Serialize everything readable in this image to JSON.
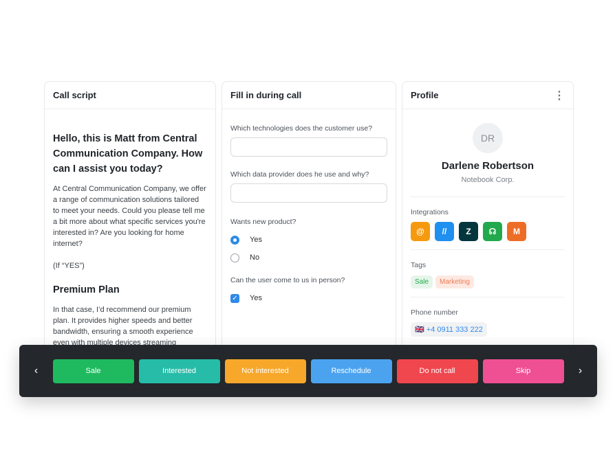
{
  "call_script": {
    "title": "Call script",
    "heading": "Hello, this is Matt from Central Communication Company. How can I assist you today?",
    "para1": "At Central Communication Company, we offer a range of communication solutions tailored to meet your needs. Could you please tell me a bit more about what specific services you're interested in? Are you looking for home internet?",
    "condition": "(If “YES”)",
    "subheading": "Premium Plan",
    "para2": "In that case, I’d recommend our premium plan. It provides higher speeds and better bandwidth, ensuring a smooth experience even with multiple devices streaming simultaneously."
  },
  "form": {
    "title": "Fill in during call",
    "q1": "Which technologies does the customer use?",
    "q1_value": "",
    "q2": "Which data provider does he use and why?",
    "q2_value": "",
    "q3": "Wants new product?",
    "q3_options": [
      "Yes",
      "No"
    ],
    "q3_selected": "Yes",
    "q4": "Can the user come to us in person?",
    "q4_option": "Yes",
    "q4_checked": true
  },
  "profile": {
    "title": "Profile",
    "initials": "DR",
    "name": "Darlene Robertson",
    "company": "Notebook Corp.",
    "integrations_label": "Integrations",
    "integrations": [
      {
        "icon": "chat-at-icon",
        "color": "#f59a0f"
      },
      {
        "icon": "slashes-icon",
        "color": "#1f8ff0"
      },
      {
        "icon": "zendesk-icon",
        "color": "#03363d"
      },
      {
        "icon": "headset-icon",
        "color": "#22a94d"
      },
      {
        "icon": "magento-icon",
        "color": "#ee6d26"
      }
    ],
    "tags_label": "Tags",
    "tags": [
      {
        "label": "Sale",
        "color": "#22a94d",
        "bg": "#e6f5ea"
      },
      {
        "label": "Marketing",
        "color": "#ef7a55",
        "bg": "#fde9e2"
      }
    ],
    "phone_label": "Phone number",
    "phone": "+4 0911 333 222"
  },
  "actions": [
    {
      "label": "Sale",
      "color": "#1fba5f"
    },
    {
      "label": "Interested",
      "color": "#26bca8"
    },
    {
      "label": "Not interested",
      "color": "#f7a72a"
    },
    {
      "label": "Reschedule",
      "color": "#4ba3ef"
    },
    {
      "label": "Do not call",
      "color": "#f0474f"
    },
    {
      "label": "Skip",
      "color": "#ef4f93"
    }
  ]
}
